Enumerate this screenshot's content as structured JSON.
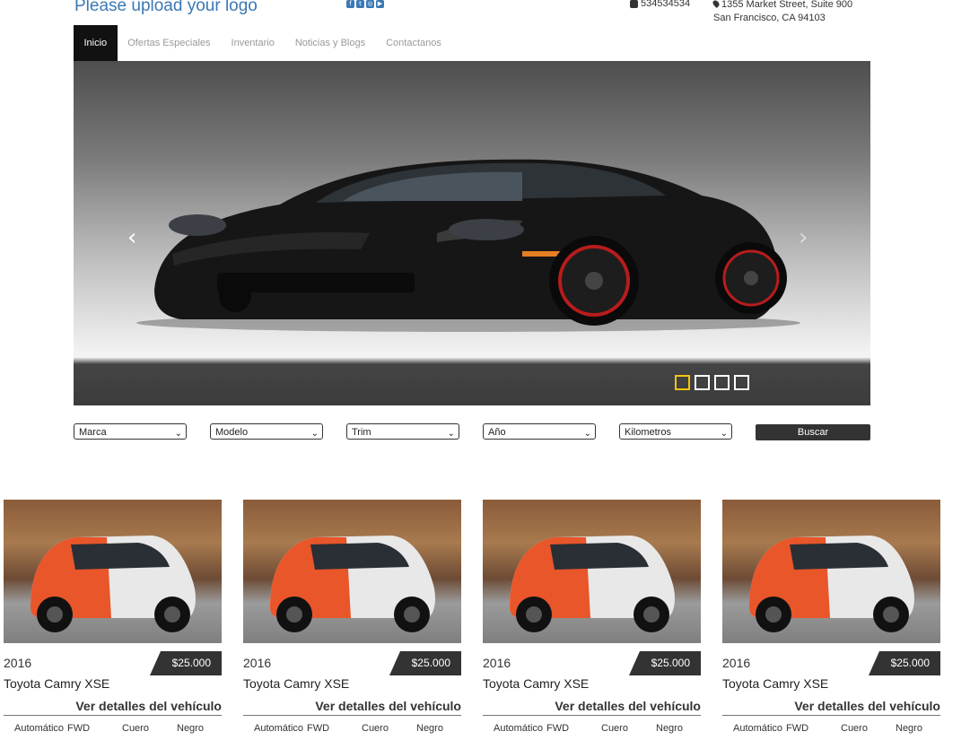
{
  "header": {
    "logo_text": "Please upload your logo",
    "social_icons": [
      "facebook-icon",
      "twitter-icon",
      "instagram-icon",
      "youtube-icon"
    ],
    "phone": "534534534",
    "address_line1": "1355 Market Street, Suite 900",
    "address_line2": "San Francisco, CA 94103"
  },
  "nav": {
    "items": [
      {
        "label": "Inicio",
        "active": true
      },
      {
        "label": "Ofertas Especiales"
      },
      {
        "label": "Inventario"
      },
      {
        "label": "Noticias y Blogs"
      },
      {
        "label": "Contactanos"
      }
    ]
  },
  "slider": {
    "prev_icon": "chevron-left-icon",
    "next_icon": "chevron-right-icon",
    "indicators": 4,
    "active_index": 0,
    "active_color": "#f1c40f"
  },
  "search": {
    "selects": [
      "Marca",
      "Modelo",
      "Trim",
      "Año",
      "Kilometros"
    ],
    "button_label": "Buscar"
  },
  "vehicles": [
    {
      "year": "2016",
      "price": "$25.000",
      "model": "Toyota Camry XSE",
      "details_label": "Ver detalles del vehículo",
      "transmission": "Automático",
      "drive": "FWD",
      "interior": "Cuero",
      "color": "Negro"
    },
    {
      "year": "2016",
      "price": "$25.000",
      "model": "Toyota Camry XSE",
      "details_label": "Ver detalles del vehículo",
      "transmission": "Automático",
      "drive": "FWD",
      "interior": "Cuero",
      "color": "Negro"
    },
    {
      "year": "2016",
      "price": "$25.000",
      "model": "Toyota Camry XSE",
      "details_label": "Ver detalles del vehículo",
      "transmission": "Automático",
      "drive": "FWD",
      "interior": "Cuero",
      "color": "Negro"
    },
    {
      "year": "2016",
      "price": "$25.000",
      "model": "Toyota Camry XSE",
      "details_label": "Ver detalles del vehículo",
      "transmission": "Automático",
      "drive": "FWD",
      "interior": "Cuero",
      "color": "Negro"
    }
  ]
}
